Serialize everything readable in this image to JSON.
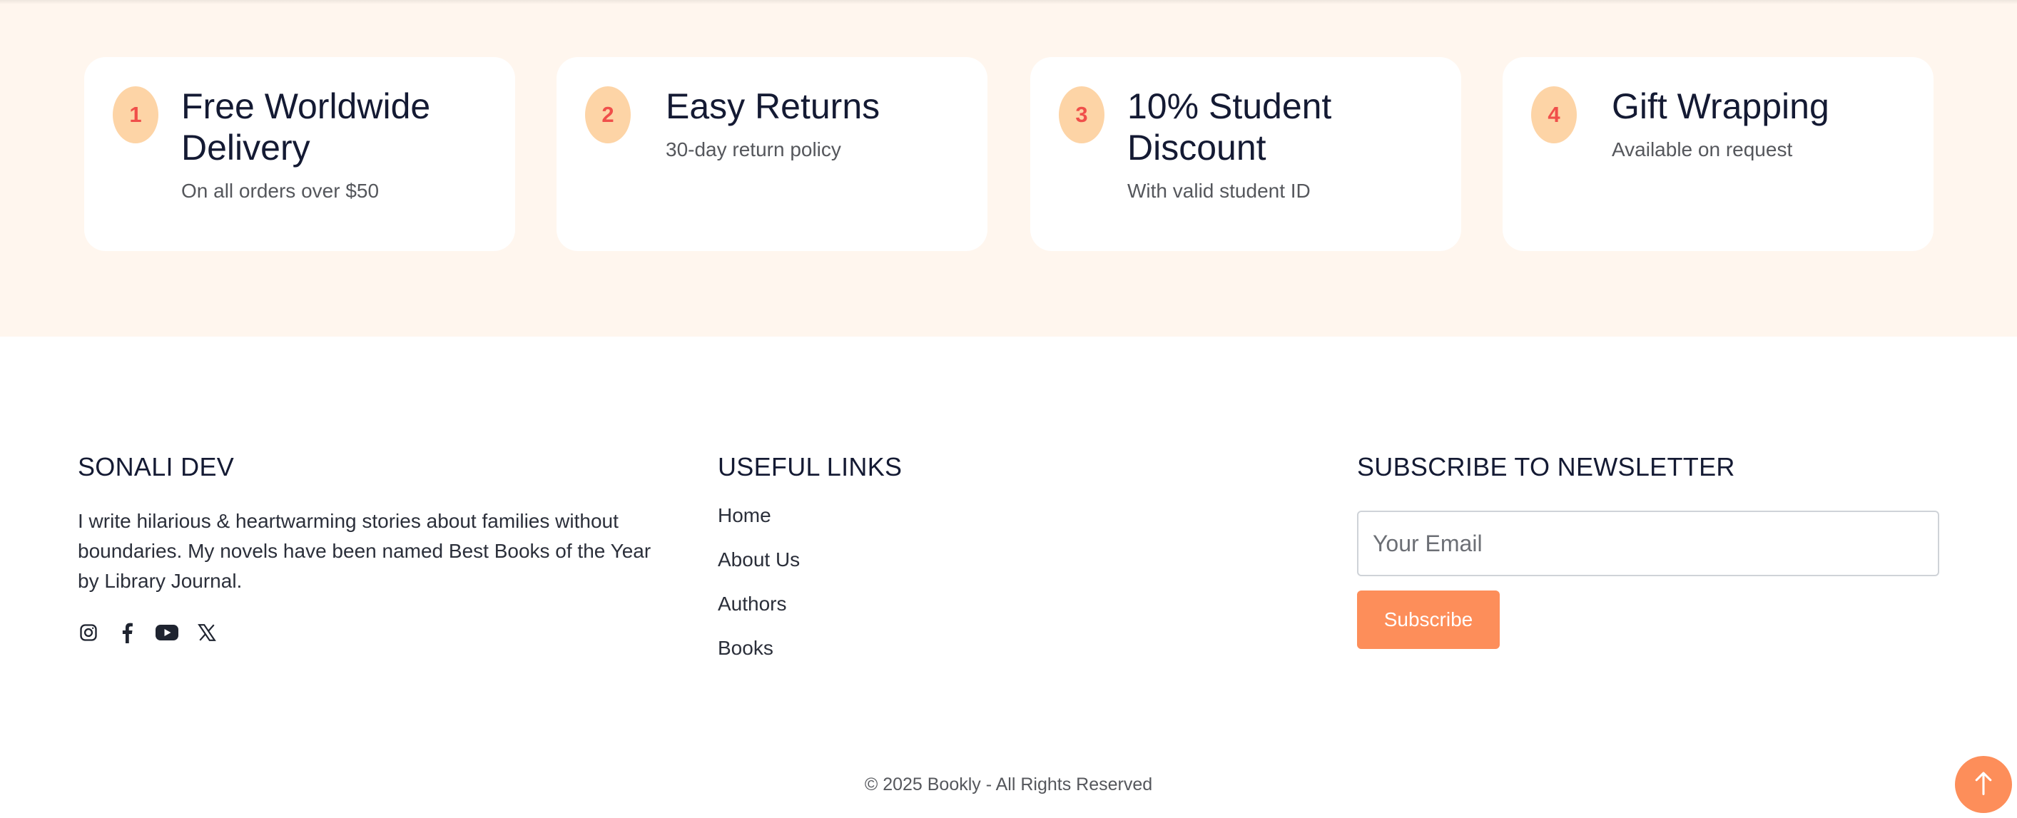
{
  "features": [
    {
      "number": "1",
      "title": "Free Worldwide Delivery",
      "subtitle": "On all orders over $50"
    },
    {
      "number": "2",
      "title": "Easy Returns",
      "subtitle": "30-day return policy"
    },
    {
      "number": "3",
      "title": "10% Student Discount",
      "subtitle": "With valid student ID"
    },
    {
      "number": "4",
      "title": "Gift Wrapping",
      "subtitle": "Available on request"
    }
  ],
  "about": {
    "heading": "SONALI DEV",
    "text": "I write hilarious & heartwarming stories about families without boundaries. My novels have been named Best Books of the Year by Library Journal.",
    "social_icons": [
      "instagram-icon",
      "facebook-icon",
      "youtube-icon",
      "x-icon"
    ]
  },
  "links": {
    "heading": "USEFUL LINKS",
    "items": [
      "Home",
      "About Us",
      "Authors",
      "Books"
    ]
  },
  "newsletter": {
    "heading": "SUBSCRIBE TO NEWSLETTER",
    "placeholder": "Your Email",
    "button_label": "Subscribe"
  },
  "footer": {
    "copyright": "© 2025 Bookly - All Rights Reserved"
  },
  "colors": {
    "accent": "#fd8e5a",
    "feature_background": "#fff6ee",
    "badge": "#fdd4a6",
    "badge_text": "#f04f4a"
  }
}
